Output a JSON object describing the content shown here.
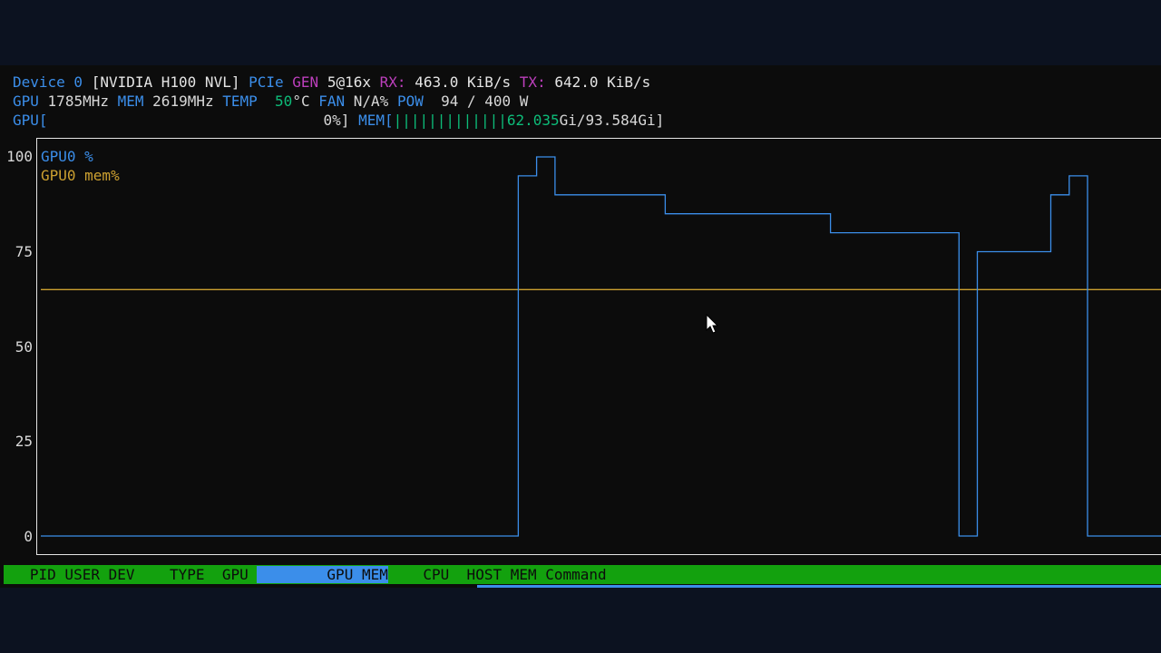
{
  "header": {
    "line1": {
      "device": "Device 0",
      "model": "[NVIDIA H100 NVL]",
      "pcie": "PCIe",
      "gen_label": "GEN",
      "gen_value": "5@16x",
      "rx_label": "RX:",
      "rx_value": "463.0 KiB/s",
      "tx_label": "TX:",
      "tx_value": "642.0 KiB/s"
    },
    "line2": {
      "gpu_label": "GPU",
      "gpu_clock": "1785MHz",
      "mem_label": "MEM",
      "mem_clock": "2619MHz",
      "temp_label": "TEMP",
      "temp_value": "50",
      "temp_unit": "°C",
      "fan_label": "FAN",
      "fan_value": "N/A%",
      "pow_label": "POW",
      "pow_value": "94 / 400 W"
    },
    "line3": {
      "gpu_label": "GPU[",
      "gpu_util": "0%]",
      "mem_label": "MEM[",
      "mem_bars": "|||||||||||||",
      "mem_used": "62.035",
      "mem_total": "Gi/93.584Gi]"
    }
  },
  "chart_data": {
    "type": "line",
    "ylim": [
      0,
      100
    ],
    "yticks": [
      "100",
      "75",
      "50",
      "25",
      "0"
    ],
    "x": [
      0,
      1,
      2,
      3,
      4,
      5,
      6,
      7,
      8,
      9,
      10,
      11,
      12,
      13,
      14,
      15,
      16,
      17,
      18,
      19,
      20,
      21,
      22,
      23,
      24,
      25,
      26,
      27,
      28,
      29,
      30,
      31,
      32,
      33,
      34,
      35,
      36,
      37,
      38,
      39,
      40,
      41,
      42,
      43,
      44,
      45,
      46,
      47,
      48,
      49,
      50,
      51,
      52,
      53,
      54,
      55,
      56,
      57,
      58,
      59,
      60,
      61
    ],
    "series": [
      {
        "name": "GPU0 %",
        "color": "#3b8eea",
        "values": [
          0,
          0,
          0,
          0,
          0,
          0,
          0,
          0,
          0,
          0,
          0,
          0,
          0,
          0,
          0,
          0,
          0,
          0,
          0,
          0,
          0,
          0,
          0,
          0,
          0,
          0,
          95,
          100,
          90,
          90,
          90,
          90,
          90,
          90,
          85,
          85,
          85,
          85,
          85,
          85,
          85,
          85,
          85,
          80,
          80,
          80,
          80,
          80,
          80,
          80,
          0,
          75,
          75,
          75,
          75,
          90,
          95,
          0,
          0,
          0,
          0,
          0
        ]
      },
      {
        "name": "GPU0 mem%",
        "color": "#cca030",
        "values": [
          65,
          65,
          65,
          65,
          65,
          65,
          65,
          65,
          65,
          65,
          65,
          65,
          65,
          65,
          65,
          65,
          65,
          65,
          65,
          65,
          65,
          65,
          65,
          65,
          65,
          65,
          65,
          65,
          65,
          65,
          65,
          65,
          65,
          65,
          65,
          65,
          65,
          65,
          65,
          65,
          65,
          65,
          65,
          65,
          65,
          65,
          65,
          65,
          65,
          65,
          65,
          65,
          65,
          65,
          65,
          65,
          65,
          65,
          65,
          65,
          65,
          65
        ]
      }
    ]
  },
  "process_table": {
    "columns_pre": "   PID USER DEV    TYPE  GPU ",
    "column_sorted": "        GPU MEM",
    "columns_post": "    CPU  HOST MEM Command"
  }
}
